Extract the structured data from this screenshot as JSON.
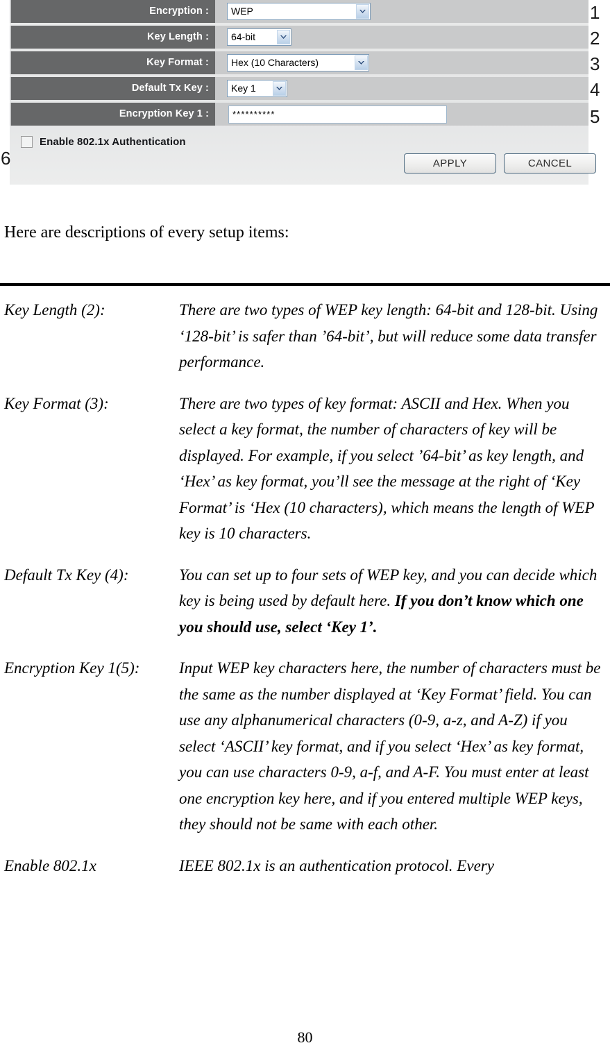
{
  "screenshot": {
    "rows": [
      {
        "label": "Encryption :",
        "control": "select",
        "value": "WEP",
        "callout": "1"
      },
      {
        "label": "Key Length :",
        "control": "select",
        "value": "64-bit",
        "callout": "2"
      },
      {
        "label": "Key Format :",
        "control": "select",
        "value": "Hex (10 Characters)",
        "callout": "3"
      },
      {
        "label": "Default Tx Key :",
        "control": "select",
        "value": "Key 1",
        "callout": "4"
      },
      {
        "label": "Encryption Key 1 :",
        "control": "text",
        "value": "**********",
        "callout": "5"
      }
    ],
    "checkbox": {
      "label": "Enable 802.1x Authentication",
      "checked": false,
      "callout": "6"
    },
    "buttons": {
      "apply": "APPLY",
      "cancel": "CANCEL"
    },
    "colors": {
      "label_cell": "#666768",
      "row_background": "#c9cacb",
      "panel_background": "#e8e9ea",
      "select_border": "#7f9db9",
      "button_border": "#4d6a80"
    }
  },
  "document": {
    "intro": "Here are descriptions of every setup items:",
    "entries": [
      {
        "term": "Key Length (2):",
        "body": "There are two types of WEP key length: 64-bit and 128-bit. Using ‘128-bit’ is safer than ’64-bit’, but will reduce some data transfer performance."
      },
      {
        "term": "Key Format (3):",
        "body": "There are two types of key format: ASCII and Hex. When you select a key format, the number of characters of key will be displayed. For example, if you select ’64-bit’ as key length, and ‘Hex’ as key format, you’ll see the message at the right of ‘Key Format’ is ‘Hex (10 characters), which means the length of WEP key is 10 characters."
      },
      {
        "term": "Default Tx Key (4):",
        "body_normal": "You can set up to four sets of WEP key, and you can decide which key is being used by default here. ",
        "body_bold": "If you don’t know which one you should use, select ‘Key 1’."
      },
      {
        "term": "Encryption Key 1(5):",
        "body": "Input WEP key characters here, the number of characters must be the same as the number displayed at ‘Key Format’ field. You can use any alphanumerical characters (0-9, a-z, and A-Z) if you select ‘ASCII’ key format, and if you select ‘Hex’ as key format, you can use characters 0-9, a-f, and A-F. You must enter at least one encryption key here, and if you entered multiple WEP keys, they should not be same with each other."
      },
      {
        "term": "Enable 802.1x",
        "body": "IEEE 802.1x is an authentication protocol. Every"
      }
    ],
    "page_number": "80"
  }
}
